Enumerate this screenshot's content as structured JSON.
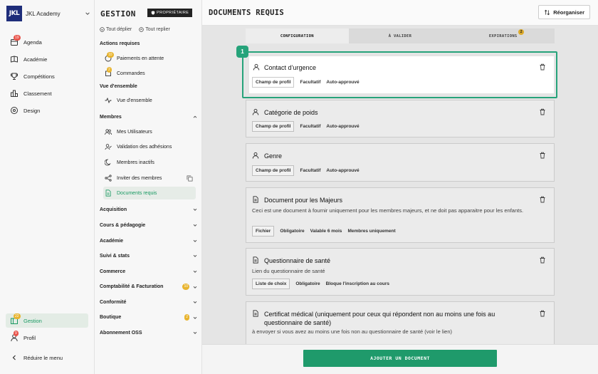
{
  "app": {
    "brand": "JKL Academy",
    "logo_text": "JKL"
  },
  "nav": {
    "items": [
      {
        "label": "Agenda",
        "badge": "19"
      },
      {
        "label": "Académie"
      },
      {
        "label": "Compétitions"
      },
      {
        "label": "Classement"
      },
      {
        "label": "Design"
      }
    ],
    "bottom": [
      {
        "label": "Gestion",
        "badge": "22"
      },
      {
        "label": "Profil",
        "badge": "9"
      }
    ],
    "collapse": "Réduire le menu"
  },
  "gestion": {
    "title": "GESTION",
    "owner_badge": "PROPRIÉTAIRE",
    "expand_all": "Tout déplier",
    "collapse_all": "Tout replier",
    "actions_title": "Actions requises",
    "actions": [
      {
        "label": "Paiements en attente",
        "badge": "10"
      },
      {
        "label": "Commandes",
        "badge": "2"
      }
    ],
    "overview_title": "Vue d'ensemble",
    "overview_item": "Vue d'ensemble",
    "members_title": "Membres",
    "members": [
      {
        "label": "Mes Utilisateurs"
      },
      {
        "label": "Validation des adhésions"
      },
      {
        "label": "Membres inactifs"
      },
      {
        "label": "Inviter des membres"
      },
      {
        "label": "Documents requis"
      }
    ],
    "sections": [
      {
        "label": "Acquisition"
      },
      {
        "label": "Cours & pédagogie"
      },
      {
        "label": "Académie"
      },
      {
        "label": "Suivi & stats"
      },
      {
        "label": "Commerce"
      },
      {
        "label": "Comptabilité & Facturation",
        "badge": "10"
      },
      {
        "label": "Conformité"
      },
      {
        "label": "Boutique",
        "badge": "2"
      },
      {
        "label": "Abonnement OSS"
      }
    ]
  },
  "main": {
    "title": "DOCUMENTS REQUIS",
    "reorder_label": "Réorganiser",
    "tabs": [
      {
        "label": "CONFIGURATION"
      },
      {
        "label": "À VALIDER"
      },
      {
        "label": "EXPIRATIONS",
        "badge": "2"
      }
    ],
    "step_number": "1",
    "cards": [
      {
        "title": "Contact d’urgence",
        "desc": "",
        "tags": [
          "Champ de profil",
          "Facultatif",
          "Auto-approuvé"
        ]
      },
      {
        "title": "Catégorie de poids",
        "desc": "",
        "tags": [
          "Champ de profil",
          "Facultatif",
          "Auto-approuvé"
        ]
      },
      {
        "title": "Genre",
        "desc": "",
        "tags": [
          "Champ de profil",
          "Facultatif",
          "Auto-approuvé"
        ]
      },
      {
        "title": "Document pour les Majeurs",
        "desc": "Ceci est une document à fournir uniquement pour les membres majeurs, et ne doit pas apparaitre pour les enfants.",
        "tags": [
          "Fichier",
          "Obligatoire",
          "Valable 6 mois",
          "Membres uniquement"
        ]
      },
      {
        "title": "Questionnaire de santé",
        "desc": "Lien du questionnaire de santé",
        "tags": [
          "Liste de choix",
          "Obligatoire",
          "Bloque l'inscription au cours"
        ]
      },
      {
        "title": "Certificat médical (uniquement pour ceux qui répondent non au moins une fois au questionnaire de santé)",
        "desc": "à envoyer si vous avez au moins une fois non au questionnaire de santé (voir le lien)",
        "tags": []
      }
    ],
    "add_button": "AJOUTER UN DOCUMENT"
  }
}
